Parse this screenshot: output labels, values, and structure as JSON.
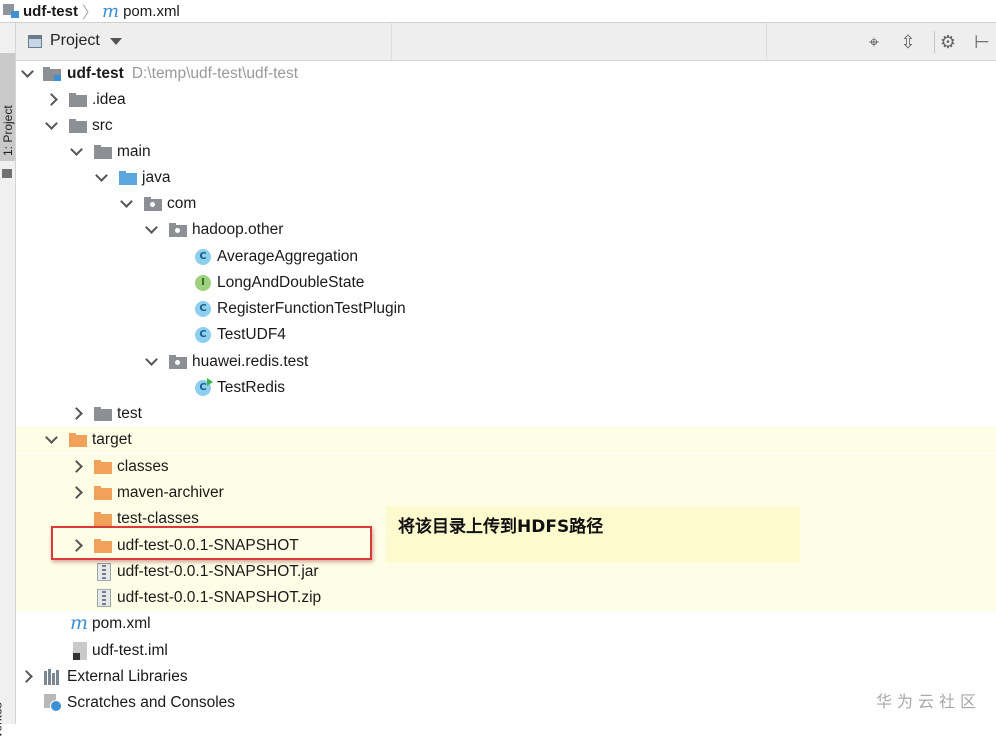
{
  "breadcrumb": {
    "project": "udf-test",
    "file": "pom.xml",
    "file_icon_glyph": "m"
  },
  "sidebar": {
    "project_tab": "1: Project",
    "favorites_tab": "vorites"
  },
  "panel": {
    "title": "Project",
    "tools": [
      "locate-icon",
      "collapse-icon",
      "gear-icon",
      "hide-icon"
    ],
    "tool_glyphs": {
      "locate": "⌖",
      "collapse": "⇳",
      "gear": "⚙",
      "hide": "⊢"
    }
  },
  "tree": {
    "root": {
      "name": "udf-test",
      "path": "D:\\temp\\udf-test\\udf-test"
    },
    "idea": ".idea",
    "src": "src",
    "main": "main",
    "java": "java",
    "com": "com",
    "pkg_hadoop": "hadoop.other",
    "classes_hadoop": [
      {
        "name": "AverageAggregation",
        "kind": "C"
      },
      {
        "name": "LongAndDoubleState",
        "kind": "I"
      },
      {
        "name": "RegisterFunctionTestPlugin",
        "kind": "C"
      },
      {
        "name": "TestUDF4",
        "kind": "C"
      }
    ],
    "pkg_huawei": "huawei.redis.test",
    "class_redis": {
      "name": "TestRedis",
      "kind": "C"
    },
    "test": "test",
    "target": "target",
    "target_children": [
      "classes",
      "maven-archiver",
      "test-classes",
      "udf-test-0.0.1-SNAPSHOT"
    ],
    "jar": "udf-test-0.0.1-SNAPSHOT.jar",
    "zip": "udf-test-0.0.1-SNAPSHOT.zip",
    "pom": "pom.xml",
    "iml": "udf-test.iml",
    "ext_libs": "External Libraries",
    "scratches": "Scratches and Consoles"
  },
  "annotation": {
    "text": "将该目录上传到HDFS路径"
  },
  "watermark": "华为云社区",
  "colors": {
    "highlight_bg": "#fefde6",
    "annotation_bg": "#fdfbce",
    "red_box": "#d93a3a",
    "accent_blue": "#3d8fd6",
    "folder_orange": "#f0a15a"
  }
}
